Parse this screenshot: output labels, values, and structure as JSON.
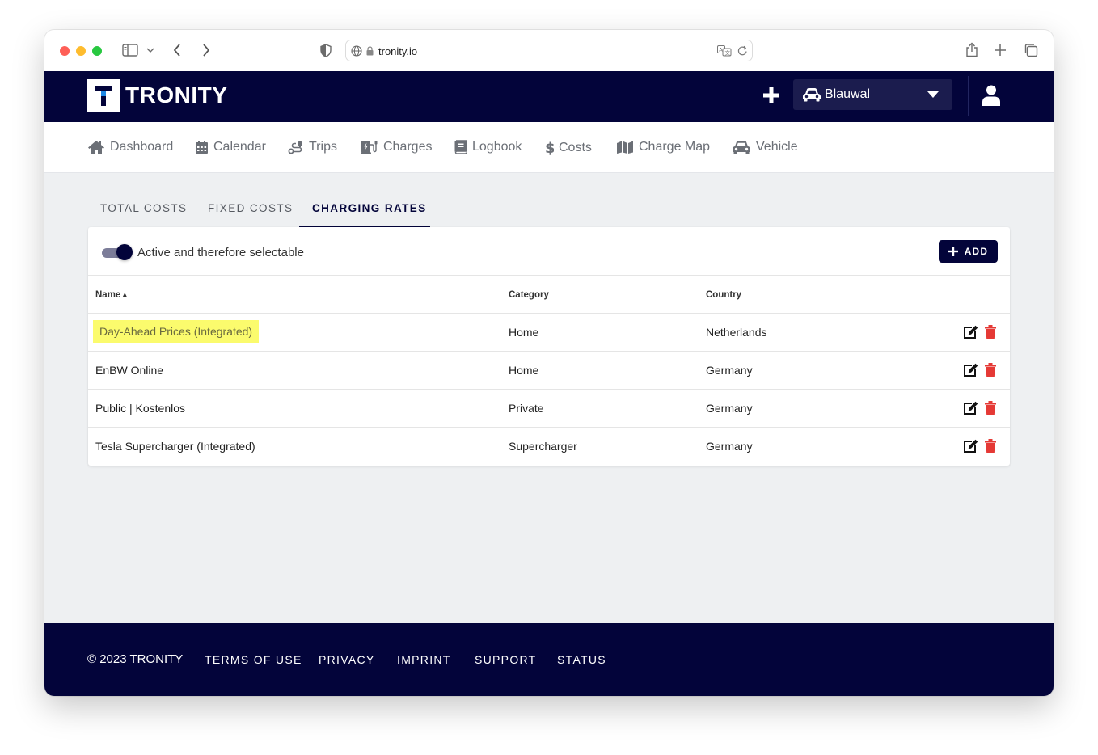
{
  "browser": {
    "url": "tronity.io"
  },
  "header": {
    "logo_letter": "T",
    "brand": "TRONITY",
    "vehicle": "Blauwal"
  },
  "nav": {
    "items": [
      {
        "label": "Dashboard",
        "icon": "home-icon"
      },
      {
        "label": "Calendar",
        "icon": "calendar-icon"
      },
      {
        "label": "Trips",
        "icon": "route-icon"
      },
      {
        "label": "Charges",
        "icon": "charging-station-icon"
      },
      {
        "label": "Logbook",
        "icon": "book-icon"
      },
      {
        "label": "Costs",
        "icon": "dollar-icon"
      },
      {
        "label": "Charge Map",
        "icon": "map-icon"
      },
      {
        "label": "Vehicle",
        "icon": "car-icon"
      }
    ]
  },
  "tabs": [
    {
      "label": "TOTAL COSTS",
      "active": false
    },
    {
      "label": "FIXED COSTS",
      "active": false
    },
    {
      "label": "CHARGING RATES",
      "active": true
    }
  ],
  "card": {
    "toggle_label": "Active and therefore selectable",
    "toggle_on": true,
    "add_label": "ADD"
  },
  "table": {
    "columns": [
      "Name",
      "Category",
      "Country"
    ],
    "sort_indicator": "▲",
    "rows": [
      {
        "name": "Day-Ahead Prices (Integrated)",
        "category": "Home",
        "country": "Netherlands",
        "highlighted": true
      },
      {
        "name": "EnBW Online",
        "category": "Home",
        "country": "Germany"
      },
      {
        "name": "Public | Kostenlos",
        "category": "Private",
        "country": "Germany"
      },
      {
        "name": "Tesla Supercharger (Integrated)",
        "category": "Supercharger",
        "country": "Germany"
      }
    ]
  },
  "footer": {
    "copyright": "© 2023 TRONITY",
    "links": [
      "TERMS OF USE",
      "PRIVACY",
      "IMPRINT",
      "SUPPORT",
      "STATUS"
    ]
  },
  "colors": {
    "brand_navy": "#03043a",
    "delete_red": "#e53935",
    "highlight": "#fbfb6d"
  }
}
